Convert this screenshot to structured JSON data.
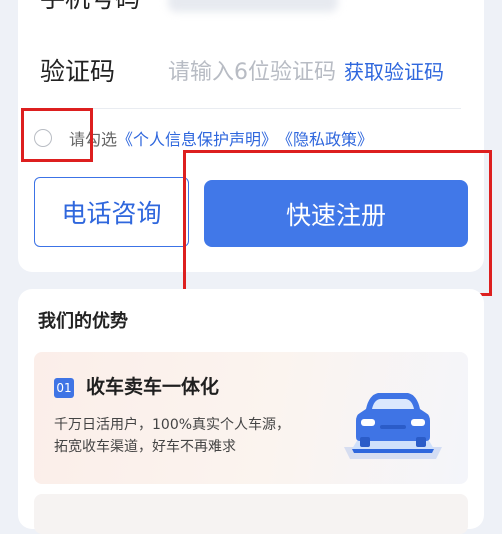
{
  "form": {
    "phone_label": "手机号码",
    "code_label": "验证码",
    "code_placeholder": "请输入6位验证码",
    "get_code_button": "获取验证码",
    "agree_prefix": "请勾选",
    "privacy_statement_link": "《个人信息保护声明》",
    "privacy_policy_link": "《隐私政策》",
    "call_button": "电话咨询",
    "register_button": "快速注册"
  },
  "advantages": {
    "title": "我们的优势",
    "features": [
      {
        "number": "01",
        "title": "收车卖车一体化",
        "desc_line1": "千万日活用户，100%真实个人车源，",
        "desc_line2": "拓宽收车渠道，好车不再难求",
        "icon": "car-on-platform-icon"
      }
    ]
  },
  "colors": {
    "accent": "#4178e8",
    "link": "#2f67dd",
    "highlight_box": "#dd1f1f",
    "background": "#eef1f7"
  }
}
